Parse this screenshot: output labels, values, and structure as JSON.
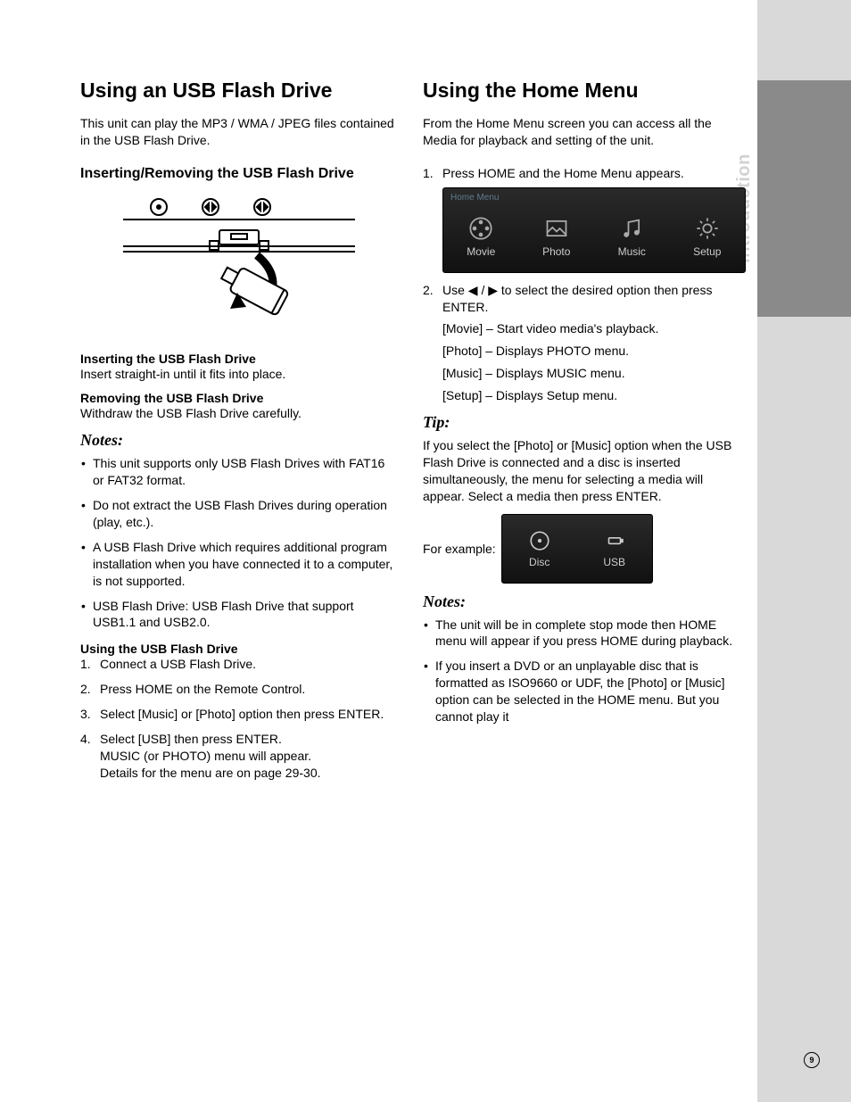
{
  "sidebar_label": "Introduction",
  "page_number": "9",
  "left": {
    "h1": "Using an USB Flash Drive",
    "intro": "This unit can play the MP3 / WMA / JPEG files contained in the USB Flash Drive.",
    "h2": "Inserting/Removing the USB Flash Drive",
    "insert_head": "Inserting the USB Flash Drive",
    "insert_body": "Insert straight-in until it fits into place.",
    "remove_head": "Removing the USB Flash Drive",
    "remove_body": "Withdraw the USB Flash Drive carefully.",
    "notes_label": "Notes:",
    "notes": [
      "This unit supports only USB Flash Drives with FAT16 or FAT32 format.",
      "Do not extract the USB Flash Drives during operation (play, etc.).",
      "A USB Flash Drive which requires additional program installation when you have connected it to a computer, is not supported.",
      "USB Flash Drive: USB Flash Drive that support USB1.1 and USB2.0."
    ],
    "using_head": "Using the USB Flash Drive",
    "steps": [
      "Connect a USB Flash Drive.",
      "Press HOME on the Remote Control.",
      "Select [Music] or [Photo] option then press ENTER.",
      "Select [USB] then press ENTER.\nMUSIC (or PHOTO) menu will appear.\nDetails for the menu are on page 29-30."
    ]
  },
  "right": {
    "h1": "Using the Home Menu",
    "intro": "From the Home Menu screen you can access all the Media for playback and setting of the unit.",
    "step1": "Press HOME and the Home Menu appears.",
    "menu_header": "Home Menu",
    "menu_items": [
      "Movie",
      "Photo",
      "Music",
      "Setup"
    ],
    "step2": "Use ◀ / ▶ to select the desired option then press ENTER.",
    "options": [
      "[Movie] – Start video media's playback.",
      "[Photo] – Displays PHOTO menu.",
      "[Music] – Displays MUSIC menu.",
      "[Setup] – Displays Setup menu."
    ],
    "tip_label": "Tip:",
    "tip_body": "If you select the [Photo] or [Music] option when the USB Flash Drive is connected and a disc is inserted simultaneously, the menu for selecting a media will appear. Select a media then press ENTER.",
    "example_label": "For example:",
    "media_items": [
      "Disc",
      "USB"
    ],
    "notes_label": "Notes:",
    "notes": [
      "The unit will be in complete stop mode then HOME menu will appear if you press HOME during playback.",
      "If you insert a DVD or an unplayable disc that is formatted as ISO9660 or UDF, the [Photo] or [Music] option can be selected in the HOME menu. But you cannot play it"
    ]
  }
}
